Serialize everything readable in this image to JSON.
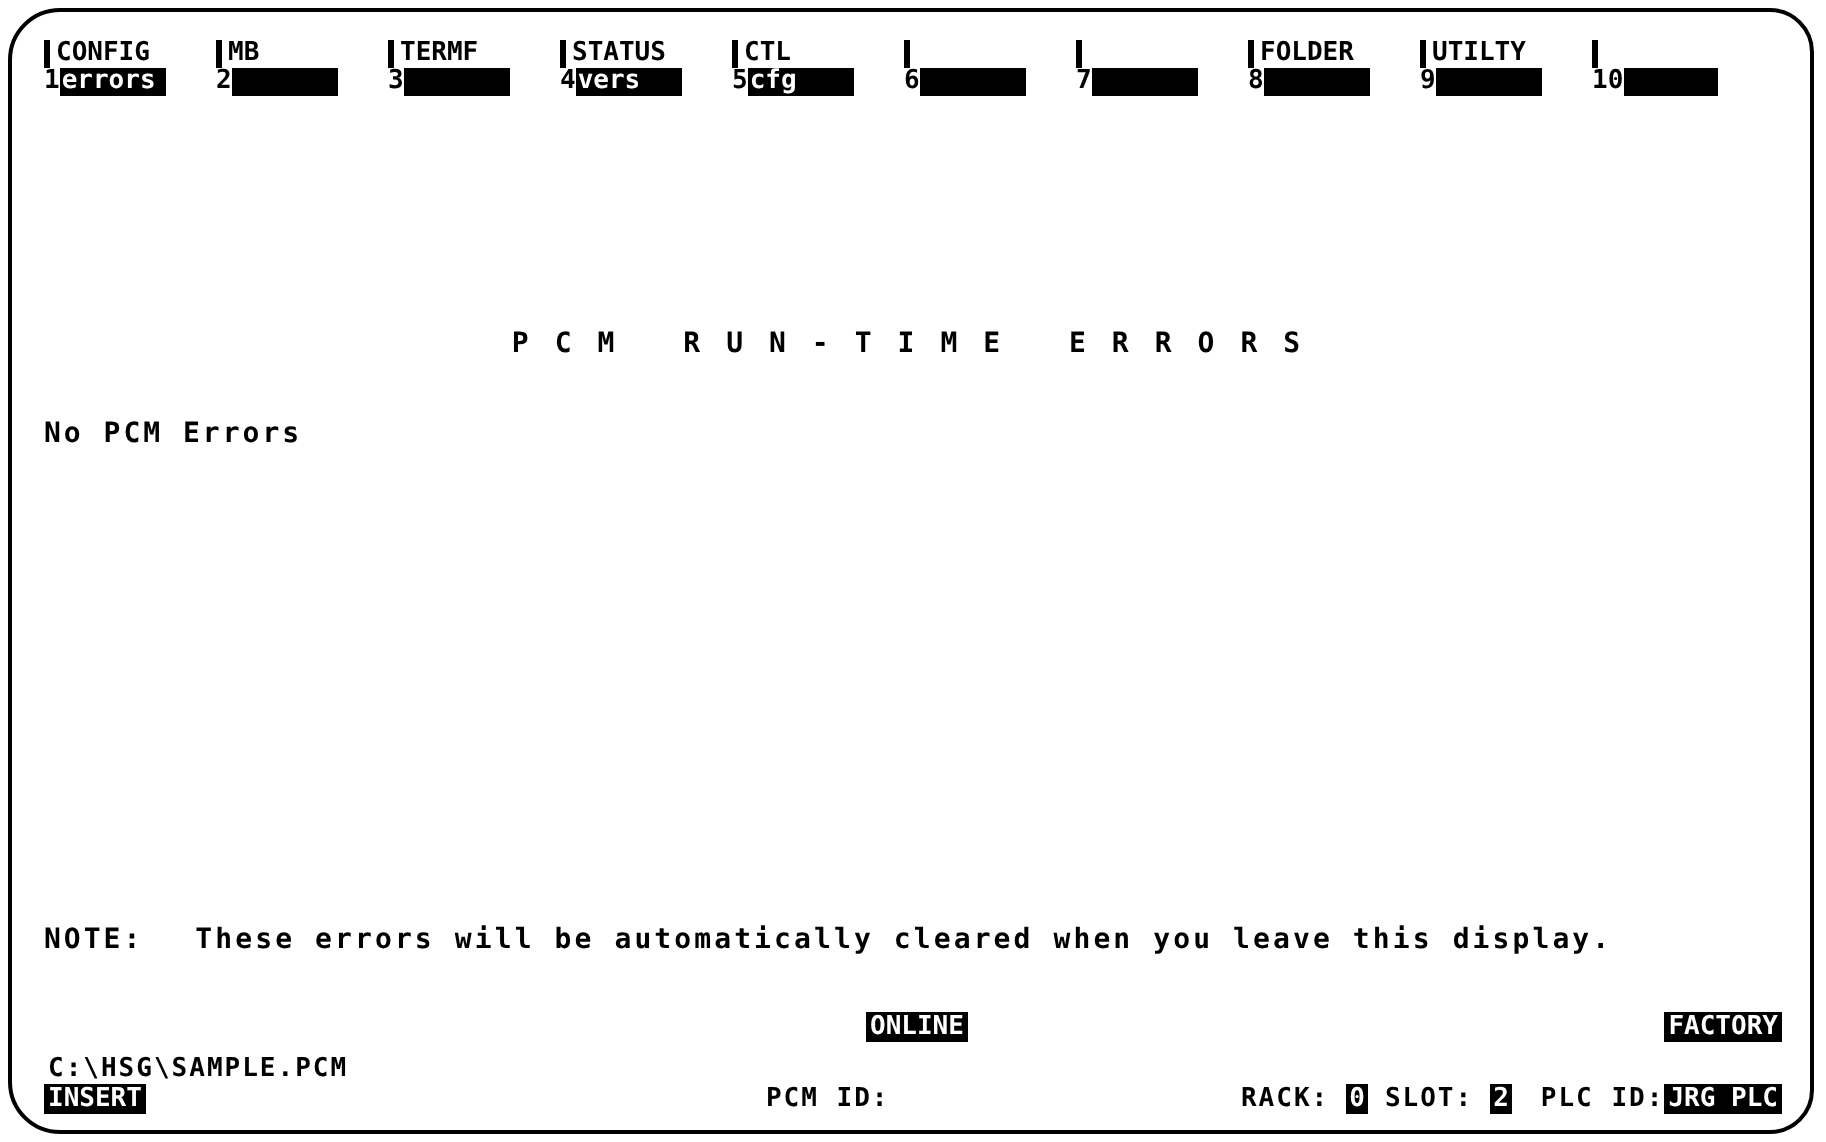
{
  "menu": [
    {
      "number": "1",
      "label": "CONFIG",
      "key": "errors"
    },
    {
      "number": "2",
      "label": "MB"
    },
    {
      "number": "3",
      "label": "TERMF"
    },
    {
      "number": "4",
      "label": "STATUS",
      "key": "vers"
    },
    {
      "number": "5",
      "label": "CTL",
      "key": "cfg"
    },
    {
      "number": "6"
    },
    {
      "number": "7"
    },
    {
      "number": "8",
      "label": "FOLDER"
    },
    {
      "number": "9",
      "label": "UTILTY"
    },
    {
      "number": "10"
    }
  ],
  "title": "PCM RUN-TIME ERRORS",
  "message": "No PCM Errors",
  "note": {
    "label": "NOTE:",
    "text": "These errors will be automatically cleared when you leave this display."
  },
  "status": {
    "mode": "ONLINE",
    "folder": "FACTORY",
    "path": "C:\\HSG\\SAMPLE.PCM",
    "edit_mode": "INSERT",
    "pcm_id_label": "PCM ID:",
    "rack_label": "RACK:",
    "rack": "0",
    "slot_label": "SLOT:",
    "slot": "2",
    "plc_id_label": "PLC ID:",
    "plc_id": "JRG PLC"
  }
}
